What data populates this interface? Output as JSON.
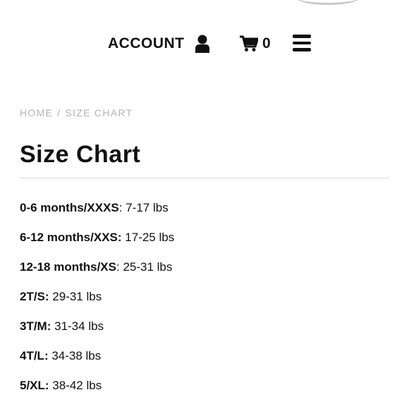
{
  "header": {
    "account_label": "ACCOUNT",
    "cart_count": "0",
    "icons": {
      "account": "user-icon",
      "cart": "cart-icon",
      "menu": "hamburger-menu-icon"
    }
  },
  "breadcrumb": {
    "home": "HOME",
    "separator": "/",
    "current": "SIZE CHART"
  },
  "page": {
    "title": "Size Chart"
  },
  "sizes": [
    {
      "size": "0-6 months/XXXS",
      "separator": ":",
      "weight": " 7-17 lbs"
    },
    {
      "size": "6-12 months/XXS:",
      "separator": "",
      "weight": " 17-25 lbs"
    },
    {
      "size": "12-18 months/XS",
      "separator": ":",
      "weight": " 25-31 lbs"
    },
    {
      "size": "2T/S:",
      "separator": "",
      "weight": " 29-31 lbs"
    },
    {
      "size": "3T/M:",
      "separator": "",
      "weight": " 31-34 lbs"
    },
    {
      "size": "4T/L:",
      "separator": "",
      "weight": " 34-38 lbs"
    },
    {
      "size": "5/XL:",
      "separator": "",
      "weight": " 38-42 lbs"
    }
  ],
  "colors": {
    "text": "#111111",
    "breadcrumb": "#b3b3b3",
    "divider": "#dcdcdc"
  }
}
